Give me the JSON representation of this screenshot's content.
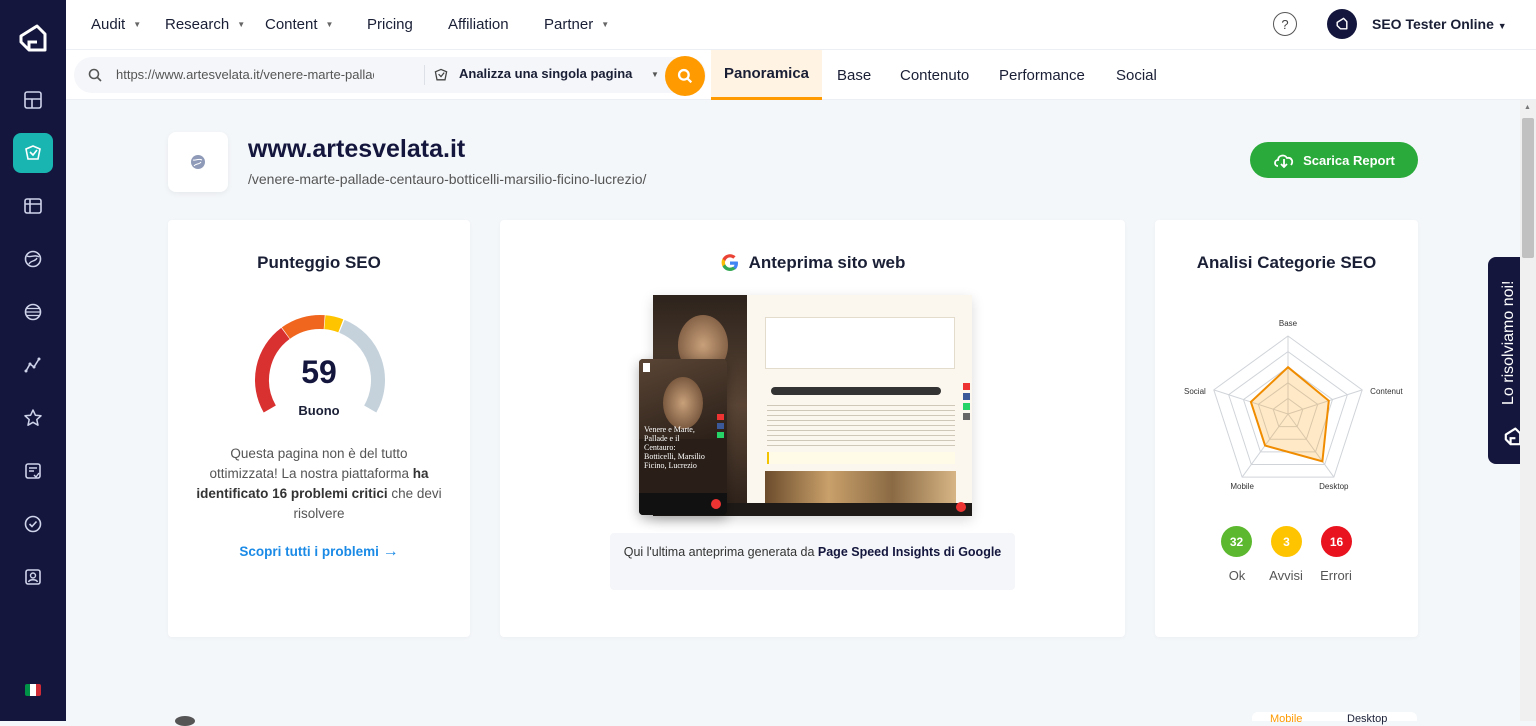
{
  "nav": {
    "items": [
      {
        "label": "Audit",
        "dropdown": true
      },
      {
        "label": "Research",
        "dropdown": true
      },
      {
        "label": "Content",
        "dropdown": true
      },
      {
        "label": "Pricing",
        "dropdown": false
      },
      {
        "label": "Affiliation",
        "dropdown": false
      },
      {
        "label": "Partner",
        "dropdown": true
      }
    ],
    "help": "?",
    "user": "SEO Tester Online"
  },
  "sidebar": {
    "items": [
      "dashboard-icon",
      "seo-audit-icon",
      "analysis-icon",
      "globe-icon",
      "planet-icon",
      "chart-icon",
      "star-icon",
      "report-icon",
      "badge-icon",
      "user-card-icon"
    ],
    "active_index": 1,
    "language": "it"
  },
  "search": {
    "url": "https://www.artesvelata.it/venere-marte-pallade-centauro-botticelli-marsilio-ficino-lucrezio/",
    "mode": "Analizza una singola pagina"
  },
  "tabs": [
    "Panoramica",
    "Base",
    "Contenuto",
    "Performance",
    "Social"
  ],
  "active_tab": 0,
  "site": {
    "domain": "www.artesvelata.it",
    "path": "/venere-marte-pallade-centauro-botticelli-marsilio-ficino-lucrezio/",
    "download": "Scarica Report"
  },
  "score_card": {
    "title": "Punteggio SEO",
    "score": "59",
    "score_value": 59,
    "label": "Buono",
    "text_pre": "Questa pagina non è del tutto ottimizzata! La nostra piattaforma ",
    "text_bold": "ha identificato 16 problemi critici",
    "text_post": " che devi risolvere",
    "link": "Scopri tutti i problemi"
  },
  "preview_card": {
    "title": "Anteprima sito web",
    "note": "Qui l'ultima anteprima generata da ",
    "note_bold": "Page Speed Insights di Google",
    "mobile_caption": "Venere e Marte, Pallade e il Centauro: Botticelli, Marsilio Ficino, Lucrezio"
  },
  "categories_card": {
    "title": "Analisi Categorie SEO",
    "axes": [
      "Base",
      "Contenuto",
      "Desktop",
      "Mobile",
      "Social"
    ],
    "values": [
      0.6,
      0.55,
      0.75,
      0.5,
      0.5
    ],
    "badges": [
      {
        "value": "32",
        "label": "Ok",
        "color": "#5cb82e"
      },
      {
        "value": "3",
        "label": "Avvisi",
        "color": "#ffc400"
      },
      {
        "value": "16",
        "label": "Errori",
        "color": "#e8131e"
      }
    ]
  },
  "feedback": "Lo risolviamo noi!",
  "bottom_toggle": {
    "mobile": "Mobile",
    "desktop": "Desktop"
  }
}
